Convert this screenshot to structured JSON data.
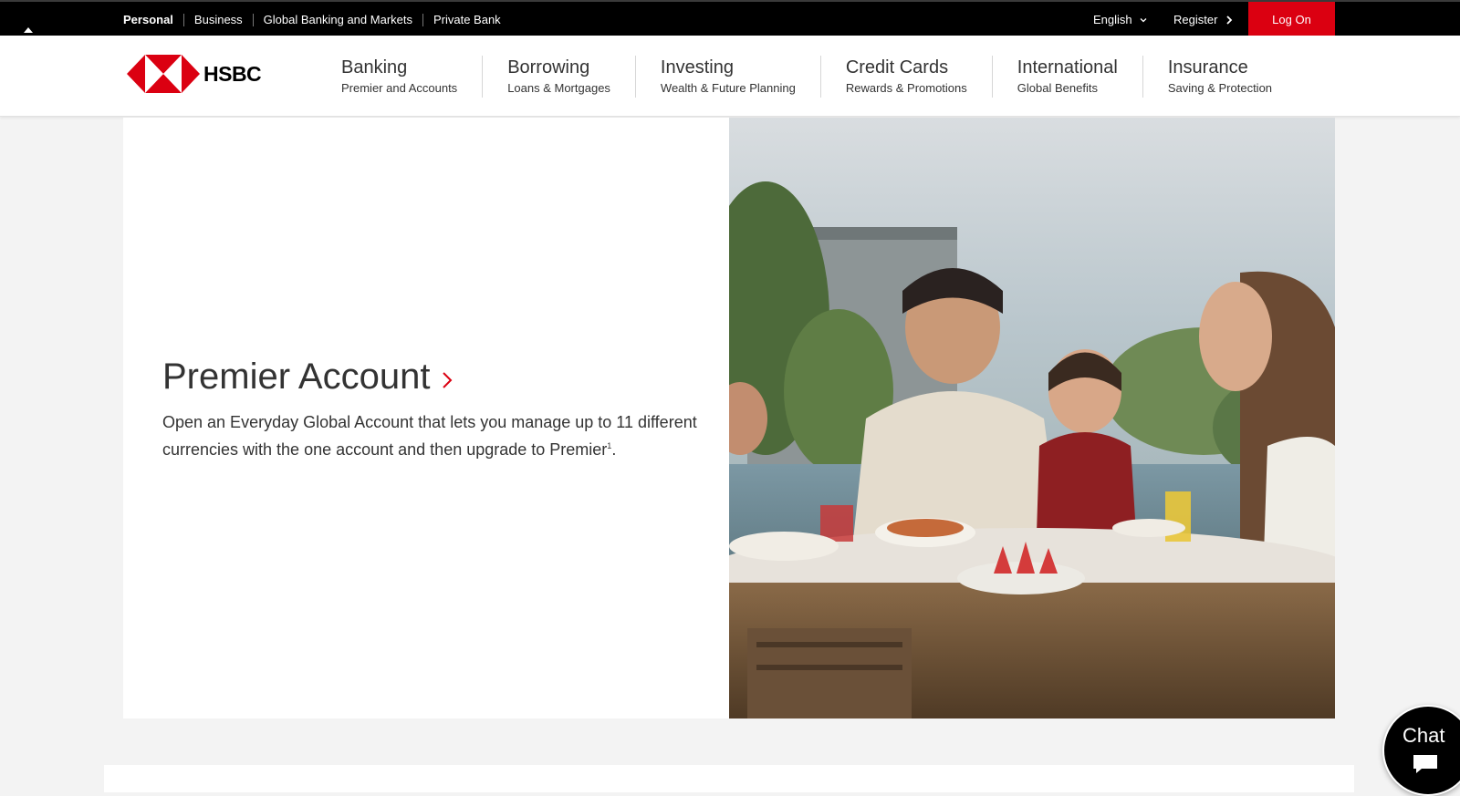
{
  "topbar": {
    "segments": [
      {
        "label": "Personal"
      },
      {
        "label": "Business"
      },
      {
        "label": "Global Banking and Markets"
      },
      {
        "label": "Private Bank"
      }
    ],
    "language": "English",
    "register": "Register",
    "logon": "Log On"
  },
  "header": {
    "logo_text": "HSBC",
    "nav": [
      {
        "title": "Banking",
        "sub": "Premier and Accounts"
      },
      {
        "title": "Borrowing",
        "sub": "Loans & Mortgages"
      },
      {
        "title": "Investing",
        "sub": "Wealth & Future Planning"
      },
      {
        "title": "Credit Cards",
        "sub": "Rewards & Promotions"
      },
      {
        "title": "International",
        "sub": "Global Benefits"
      },
      {
        "title": "Insurance",
        "sub": "Saving & Protection"
      }
    ]
  },
  "hero": {
    "title": "Premier Account",
    "description": "Open an Everyday Global Account that lets you manage up to 11 different currencies with the one account and then upgrade to Premier",
    "footnote": "1",
    "description_end": "."
  },
  "chat": {
    "label": "Chat"
  },
  "colors": {
    "brand_red": "#db0011",
    "topbar": "#000000",
    "background": "#f3f3f3"
  }
}
